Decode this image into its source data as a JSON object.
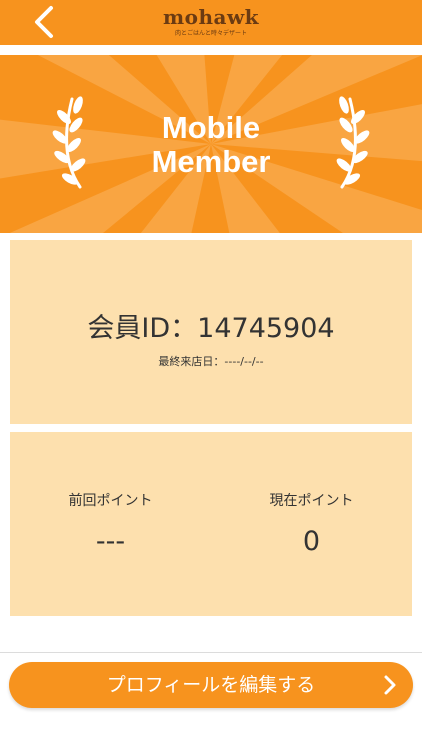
{
  "header": {
    "logo": "mohawk",
    "tagline": "肉とごはんと時々デザート",
    "back_icon": "chevron-left-icon"
  },
  "hero": {
    "title_line1": "Mobile",
    "title_line2": "Member",
    "icons": [
      "laurel-left-icon",
      "laurel-right-icon"
    ]
  },
  "member": {
    "id_text": "会員ID：14745904",
    "last_visit": "最終来店日：----/--/--"
  },
  "points": {
    "previous_label": "前回ポイント",
    "previous_value": "---",
    "current_label": "現在ポイント",
    "current_value": "0"
  },
  "footer": {
    "edit_profile_label": "プロフィールを編集する",
    "chevron_icon": "chevron-right-icon"
  },
  "colors": {
    "brand_orange": "#f7931e",
    "panel_bg": "#fde0ae",
    "logo_brown": "#6b3b12"
  }
}
